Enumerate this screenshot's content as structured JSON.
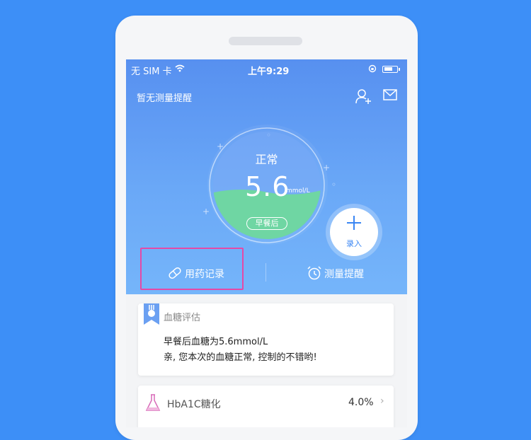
{
  "status_bar": {
    "carrier": "无 SIM 卡",
    "time": "上午9:29"
  },
  "topbar": {
    "reminder_text": "暂无测量提醒"
  },
  "gauge": {
    "status": "正常",
    "value": "5.6",
    "unit": "mmol/L",
    "period": "早餐后",
    "fill_level": 0.45
  },
  "add_button": {
    "label": "录入"
  },
  "actions": {
    "medication": "用药记录",
    "reminder": "测量提醒"
  },
  "assessment": {
    "title": "血糖评估",
    "line1": "早餐后血糖为5.6mmol/L",
    "line2": "亲, 您本次的血糖正常, 控制的不错哟!"
  },
  "hba1c": {
    "name": "HbA1C糖化",
    "value": "4.0%"
  },
  "colors": {
    "background": "#3d8ff7",
    "accent": "#3a86f3",
    "gauge_fill": "#6fd6a3",
    "highlight": "#e549a6"
  }
}
